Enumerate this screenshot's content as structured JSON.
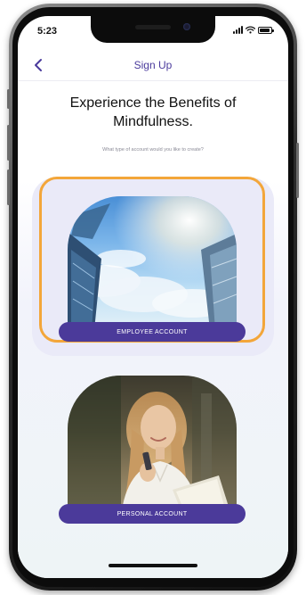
{
  "status_bar": {
    "time": "5:23",
    "signal_icon": "cellular-signal-icon",
    "wifi_icon": "wifi-icon",
    "battery_icon": "battery-icon"
  },
  "nav": {
    "back_icon": "chevron-left-icon",
    "title": "Sign Up"
  },
  "main": {
    "headline": "Experience the Benefits of Mindfulness.",
    "subhead": "What type of account would you like to create?"
  },
  "accounts": [
    {
      "label": "EMPLOYEE ACCOUNT",
      "image": "city-skyscrapers-sky-illustration",
      "selected": true
    },
    {
      "label": "PERSONAL ACCOUNT",
      "image": "woman-with-phone-illustration",
      "selected": false
    }
  ],
  "colors": {
    "accent": "#4b3a9a",
    "nav_title": "#4a3a9c",
    "selection_highlight": "#f3a63a",
    "card_background": "#eaeaf8"
  }
}
